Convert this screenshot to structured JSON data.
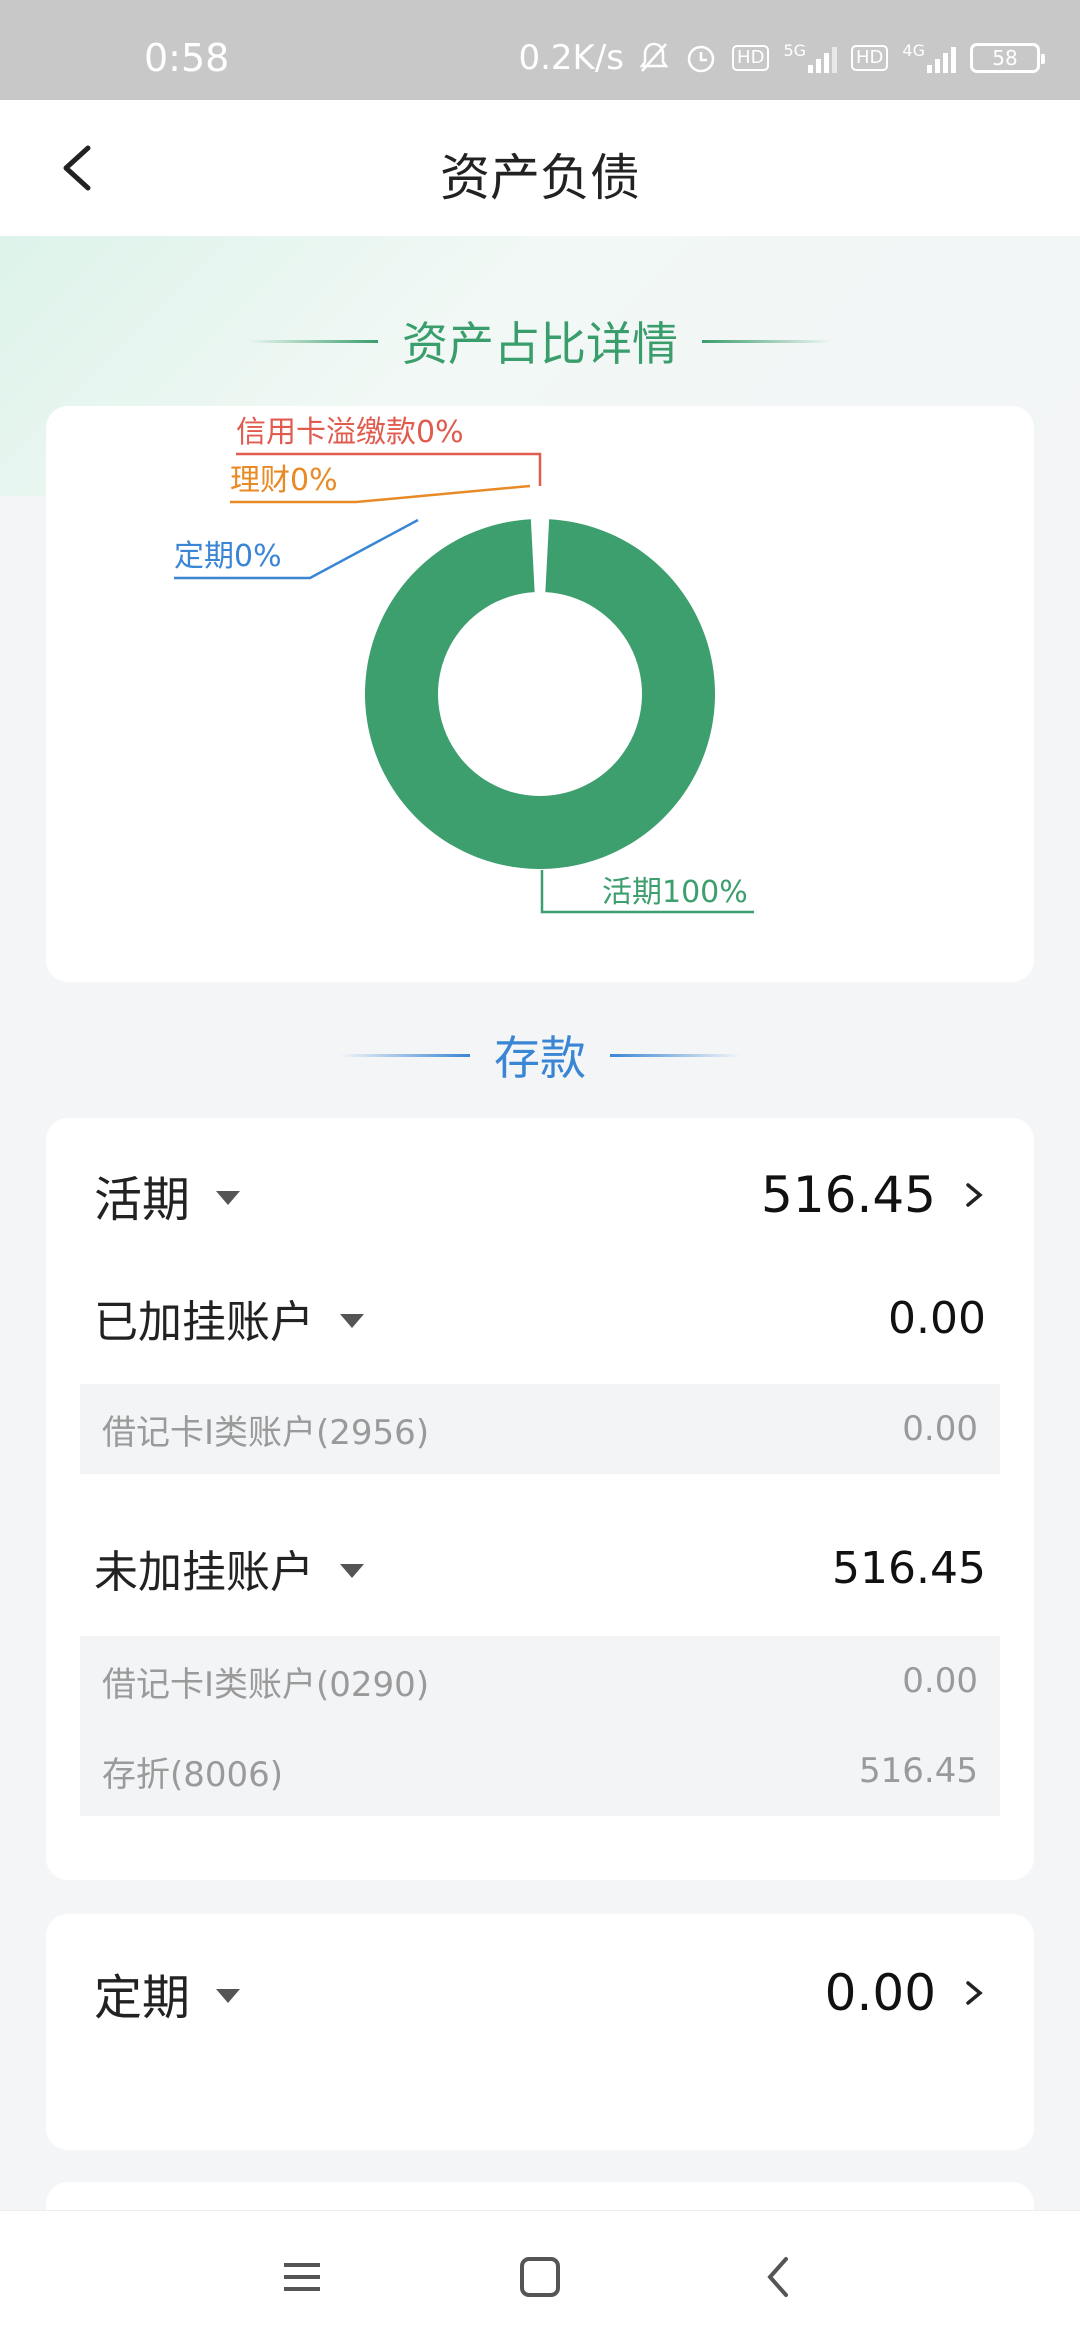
{
  "status_bar": {
    "time": "0:58",
    "net_speed": "0.2K/s",
    "network_5g": "5G",
    "network_4g": "4G",
    "hd_label": "HD",
    "battery": "58"
  },
  "header": {
    "title": "资产负债"
  },
  "asset_section": {
    "title": "资产占比详情",
    "accent": "#3a9d6c"
  },
  "chart_data": {
    "type": "pie",
    "style": "donut",
    "categories": [
      "活期",
      "定期",
      "理财",
      "信用卡溢缴款"
    ],
    "values": [
      100,
      0,
      0,
      0
    ],
    "labels": [
      "活期100%",
      "定期0%",
      "理财0%",
      "信用卡溢缴款0%"
    ],
    "colors": [
      "#3d9e6e",
      "#3a86d4",
      "#e88a26",
      "#e15b4f"
    ]
  },
  "deposit_section": {
    "title": "存款",
    "accent": "#3a86d4"
  },
  "current": {
    "label": "活期",
    "amount": "516.45",
    "linked": {
      "label": "已加挂账户",
      "amount": "0.00",
      "accounts": [
        {
          "name": "借记卡I类账户(2956)",
          "amount": "0.00"
        }
      ]
    },
    "unlinked": {
      "label": "未加挂账户",
      "amount": "516.45",
      "accounts": [
        {
          "name": "借记卡I类账户(0290)",
          "amount": "0.00"
        },
        {
          "name": "存折(8006)",
          "amount": "516.45"
        }
      ]
    }
  },
  "fixed": {
    "label": "定期",
    "amount": "0.00"
  }
}
